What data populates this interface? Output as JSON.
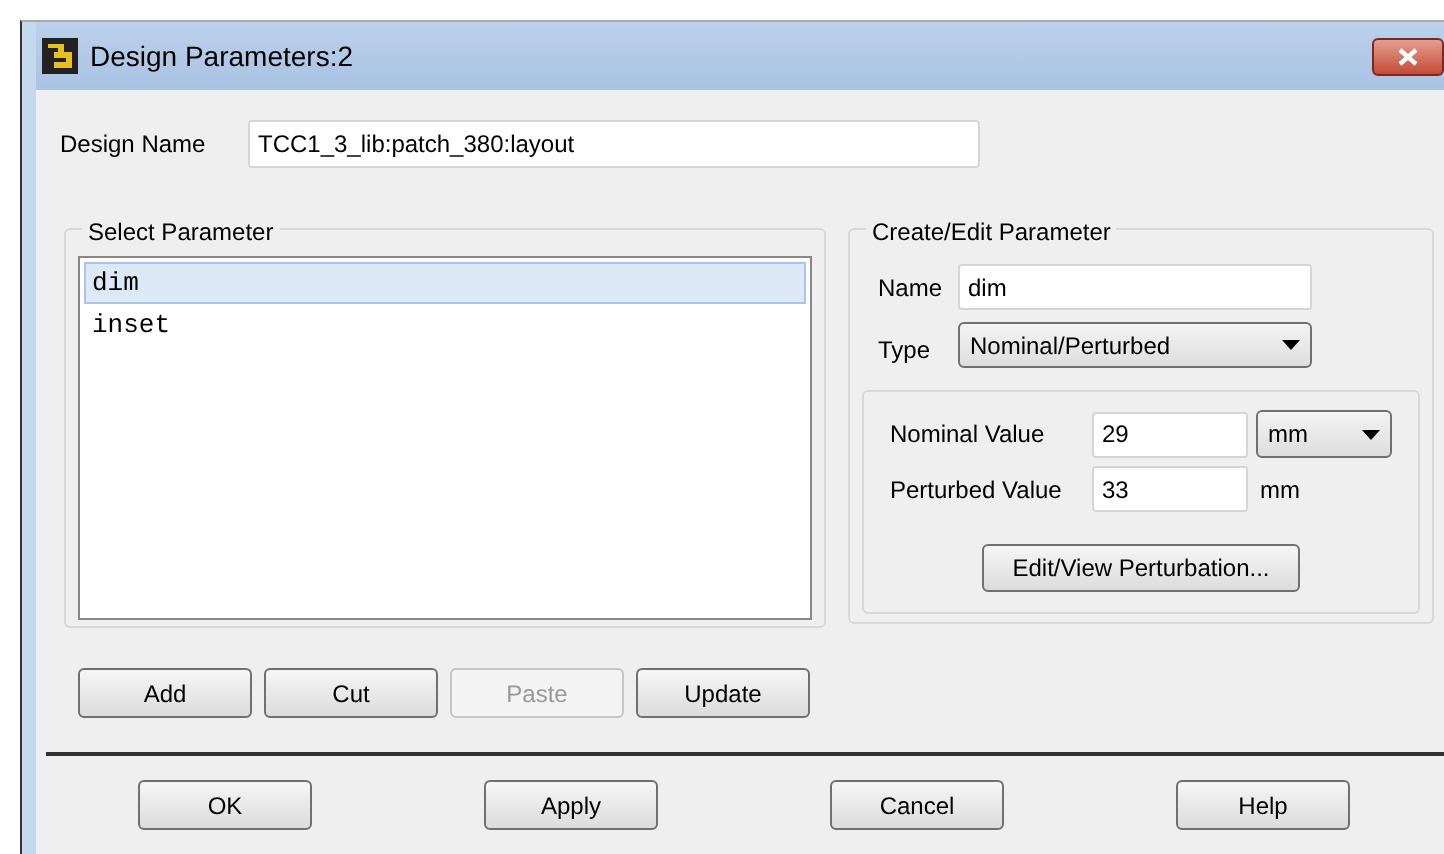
{
  "window": {
    "title": "Design Parameters:2"
  },
  "design_name": {
    "label": "Design Name",
    "value": "TCC1_3_lib:patch_380:layout"
  },
  "select_parameter": {
    "title": "Select Parameter",
    "items": [
      {
        "label": "dim",
        "selected": true
      },
      {
        "label": "inset",
        "selected": false
      }
    ]
  },
  "create_edit": {
    "title": "Create/Edit Parameter",
    "name_label": "Name",
    "name_value": "dim",
    "type_label": "Type",
    "type_value": "Nominal/Perturbed",
    "nominal_label": "Nominal Value",
    "nominal_value": "29",
    "nominal_unit": "mm",
    "perturbed_label": "Perturbed Value",
    "perturbed_value": "33",
    "perturbed_unit": "mm",
    "perturbation_button": "Edit/View Perturbation..."
  },
  "list_buttons": [
    {
      "label": "Add",
      "disabled": false
    },
    {
      "label": "Cut",
      "disabled": false
    },
    {
      "label": "Paste",
      "disabled": true
    },
    {
      "label": "Update",
      "disabled": false
    }
  ],
  "dialog_buttons": [
    "OK",
    "Apply",
    "Cancel",
    "Help"
  ]
}
